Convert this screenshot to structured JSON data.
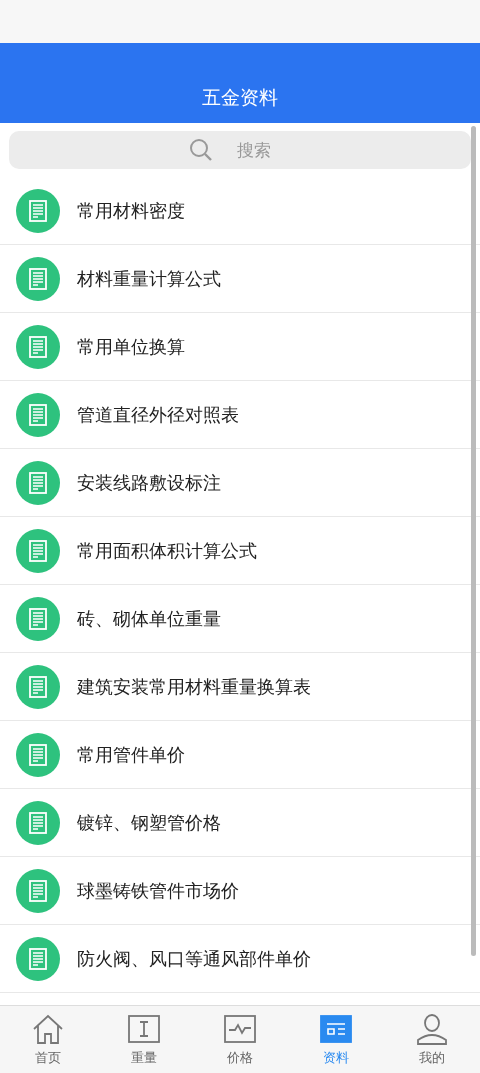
{
  "header": {
    "title": "五金资料"
  },
  "search": {
    "placeholder": "搜索"
  },
  "items": [
    {
      "title": "常用材料密度"
    },
    {
      "title": "材料重量计算公式"
    },
    {
      "title": "常用单位换算"
    },
    {
      "title": "管道直径外径对照表"
    },
    {
      "title": "安装线路敷设标注"
    },
    {
      "title": "常用面积体积计算公式"
    },
    {
      "title": "砖、砌体单位重量"
    },
    {
      "title": "建筑安装常用材料重量换算表"
    },
    {
      "title": "常用管件单价"
    },
    {
      "title": "镀锌、钢塑管价格"
    },
    {
      "title": "球墨铸铁管件市场价"
    },
    {
      "title": "防火阀、风口等通风部件单价"
    }
  ],
  "tab_bar": [
    {
      "label": "首页",
      "kind": "home",
      "selected": false
    },
    {
      "label": "重量",
      "kind": "text",
      "selected": false
    },
    {
      "label": "价格",
      "kind": "pulse",
      "selected": false
    },
    {
      "label": "资料",
      "kind": "list",
      "selected": true
    },
    {
      "label": "我的",
      "kind": "person",
      "selected": false
    }
  ]
}
